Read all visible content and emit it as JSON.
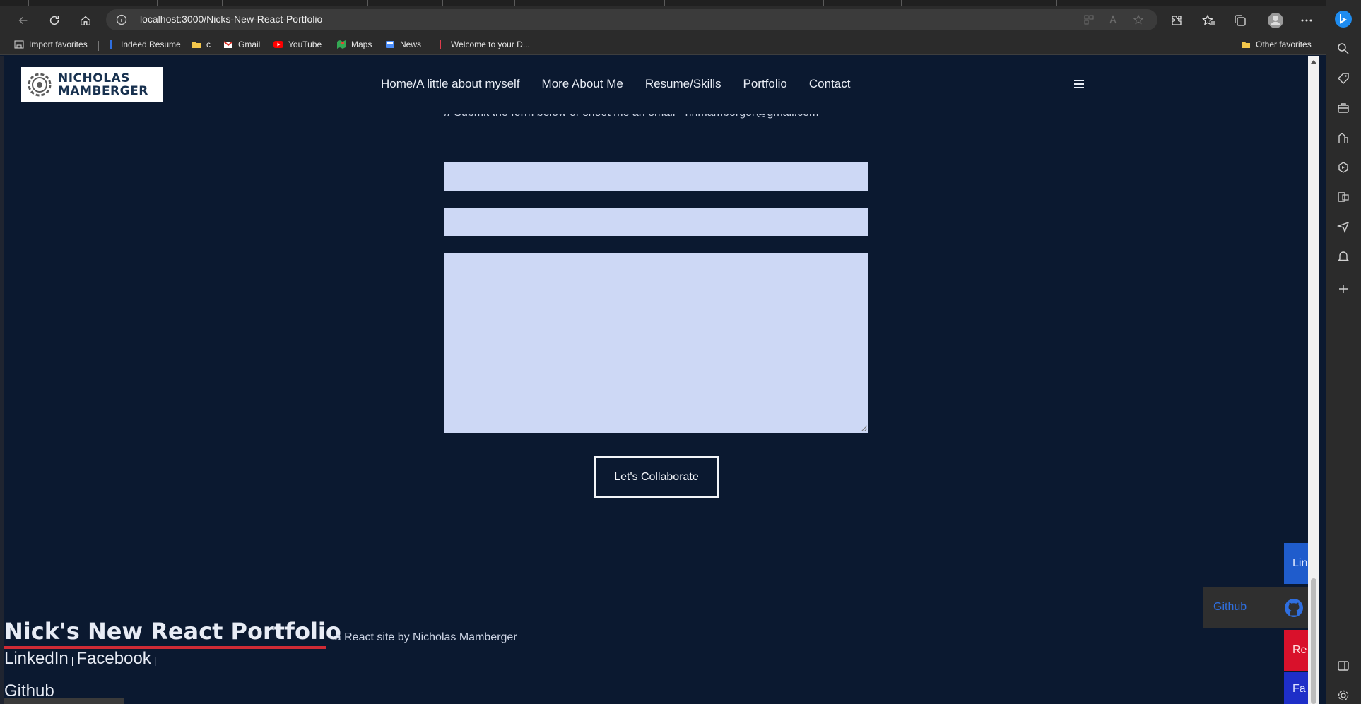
{
  "browser": {
    "url": "localhost:3000/Nicks-New-React-Portfolio",
    "bookmarks": [
      {
        "label": "Import favorites",
        "icon": "import-icon"
      },
      {
        "label": "Indeed Resume",
        "icon": "indeed-icon"
      },
      {
        "label": "c",
        "icon": "folder-icon"
      },
      {
        "label": "Gmail",
        "icon": "gmail-icon"
      },
      {
        "label": "YouTube",
        "icon": "youtube-icon"
      },
      {
        "label": "Maps",
        "icon": "maps-icon"
      },
      {
        "label": "News",
        "icon": "news-icon"
      },
      {
        "label": "Welcome to your D...",
        "icon": "bookmark-icon"
      }
    ],
    "other_favorites": "Other favorites"
  },
  "header": {
    "logo_line1": "NICHOLAS",
    "logo_line2": "MAMBERGER",
    "nav": [
      "Home/A little about myself",
      "More About Me",
      "Resume/Skills",
      "Portfolio",
      "Contact"
    ]
  },
  "contact": {
    "intro": "// Submit the form below or shoot me an email - nnmamberger@gmail.com",
    "submit_label": "Let's Collaborate"
  },
  "footer": {
    "title": "Nick's New React Portfolio",
    "subtitle": "- a React site by Nicholas Mamberger",
    "links": [
      "LinkedIn",
      "Facebook",
      "Github"
    ],
    "pipe": "|"
  },
  "social_tabs": {
    "linkedin": "Lin",
    "github": "Github",
    "resume": "Re",
    "facebook": "Fa"
  },
  "colors": {
    "page_bg": "#0b1930",
    "input_bg": "#cdd8f5",
    "accent_red": "#d02b35",
    "linkedin_blue": "#1f5ccc",
    "resume_red": "#d9112b",
    "facebook_blue": "#1e2ec8"
  }
}
